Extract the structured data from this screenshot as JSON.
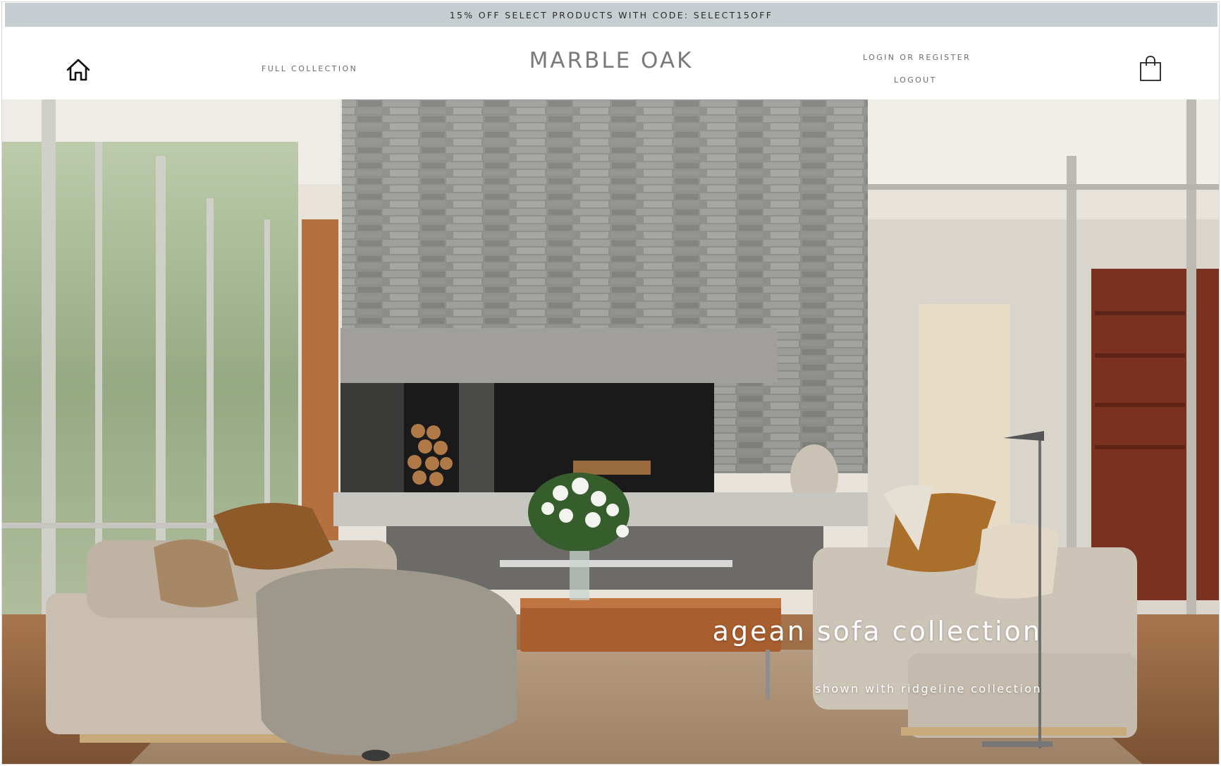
{
  "promo": {
    "text": "15% OFF SELECT PRODUCTS WITH CODE: SELECT15OFF"
  },
  "header": {
    "brand": "MARBLE OAK",
    "nav_full_collection": "FULL COLLECTION",
    "nav_login": "LOGIN OR REGISTER",
    "nav_logout": "LOGOUT",
    "home_icon": "home-icon",
    "cart_icon": "shopping-bag-icon"
  },
  "hero": {
    "title": "agean sofa collection",
    "subtitle": "shown with ridgeline collection"
  },
  "colors": {
    "promo_bg": "#c6ced1",
    "brand_text": "#7a7a7a",
    "nav_text": "#6b6b6b"
  }
}
